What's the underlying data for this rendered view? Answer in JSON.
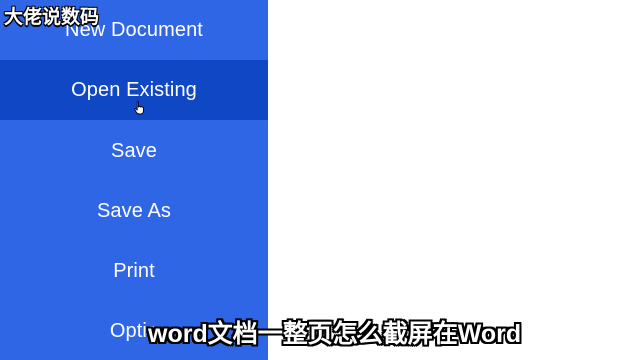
{
  "watermark": "大佬说数码",
  "menu": {
    "items": [
      {
        "label": "New Document",
        "active": false
      },
      {
        "label": "Open Existing",
        "active": true
      },
      {
        "label": "Save",
        "active": false
      },
      {
        "label": "Save As",
        "active": false
      },
      {
        "label": "Print",
        "active": false
      },
      {
        "label": "Optio",
        "active": false
      }
    ]
  },
  "subtitle": "word文档一整页怎么截屏在Word",
  "colors": {
    "sidebar": "#2f66e6",
    "active_item": "#0f47c4",
    "content_background": "#ffffff"
  },
  "icons": {
    "cursor": "hand-pointer-icon"
  }
}
